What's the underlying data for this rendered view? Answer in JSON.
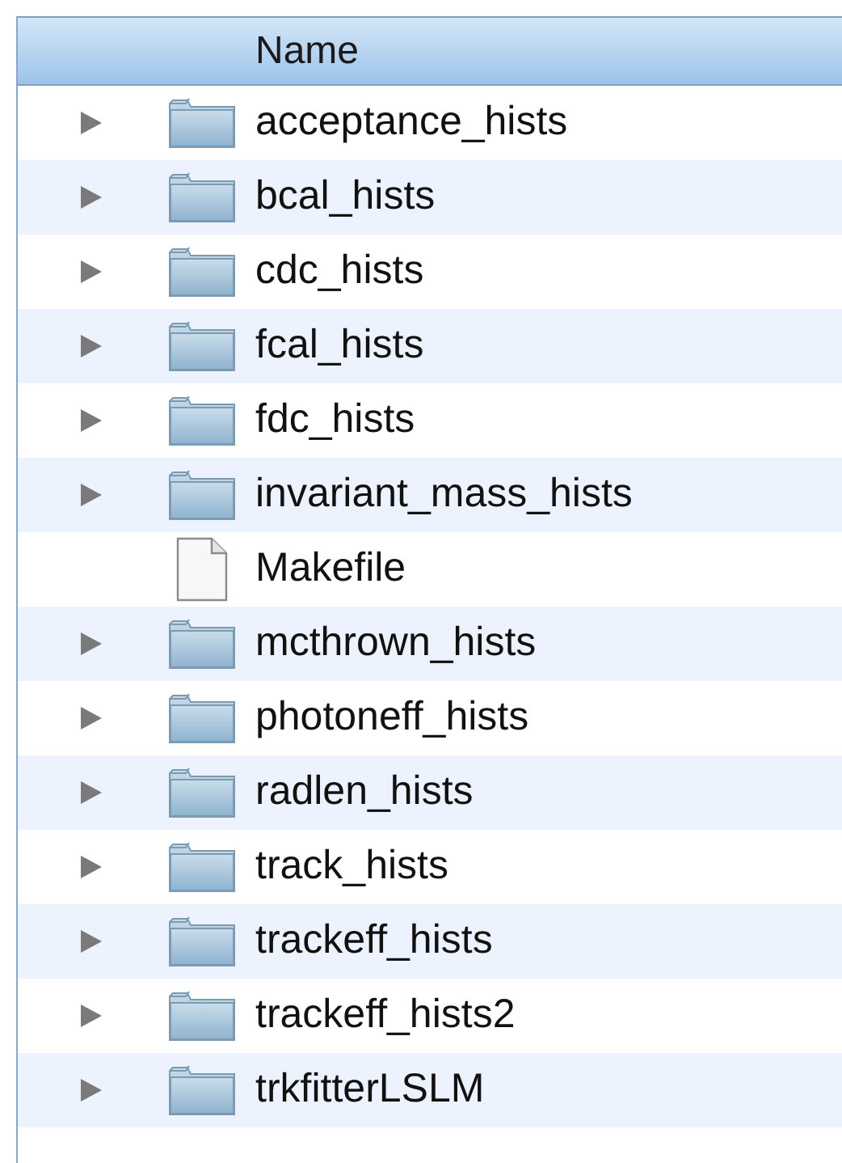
{
  "columns": [
    {
      "label": "Name"
    }
  ],
  "rows": [
    {
      "name": "acceptance_hists",
      "kind": "folder",
      "expanded": false
    },
    {
      "name": "bcal_hists",
      "kind": "folder",
      "expanded": false
    },
    {
      "name": "cdc_hists",
      "kind": "folder",
      "expanded": false
    },
    {
      "name": "fcal_hists",
      "kind": "folder",
      "expanded": false
    },
    {
      "name": "fdc_hists",
      "kind": "folder",
      "expanded": false
    },
    {
      "name": "invariant_mass_hists",
      "kind": "folder",
      "expanded": false
    },
    {
      "name": "Makefile",
      "kind": "file"
    },
    {
      "name": "mcthrown_hists",
      "kind": "folder",
      "expanded": false
    },
    {
      "name": "photoneff_hists",
      "kind": "folder",
      "expanded": false
    },
    {
      "name": "radlen_hists",
      "kind": "folder",
      "expanded": false
    },
    {
      "name": "track_hists",
      "kind": "folder",
      "expanded": false
    },
    {
      "name": "trackeff_hists",
      "kind": "folder",
      "expanded": false
    },
    {
      "name": "trackeff_hists2",
      "kind": "folder",
      "expanded": false
    },
    {
      "name": "trkfitterLSLM",
      "kind": "folder",
      "expanded": false
    }
  ]
}
